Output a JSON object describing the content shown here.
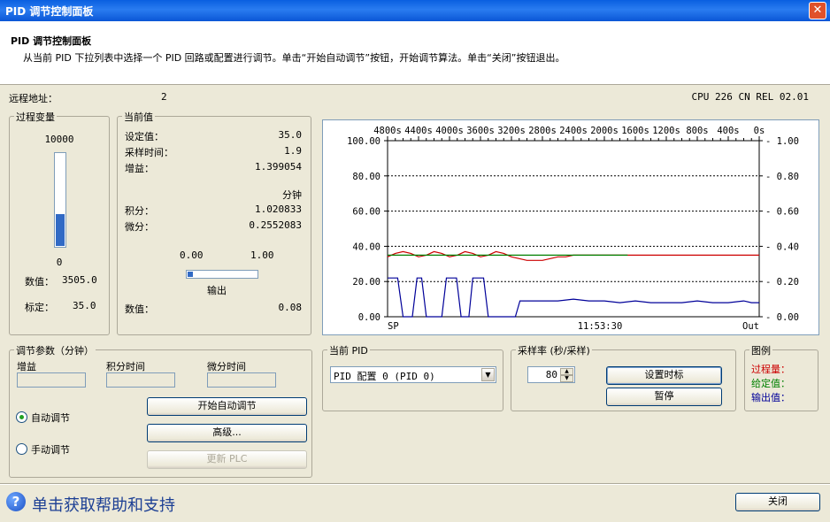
{
  "window": {
    "title": "PID 调节控制面板",
    "close_glyph": "✕"
  },
  "header": {
    "title": "PID 调节控制面板",
    "description": "从当前 PID 下拉列表中选择一个 PID 回路或配置进行调节。单击“开始自动调节”按钮，开始调节算法。单击“关闭”按钮退出。"
  },
  "remote": {
    "label": "远程地址：",
    "value": "2",
    "cpu": "CPU 226 CN REL 02.01"
  },
  "pv": {
    "legend": "过程变量",
    "max": "10000",
    "min": "0",
    "level": 0.3505,
    "value_label": "数值：",
    "value": "3505.0",
    "scale_label": "标定：",
    "scale": "35.0"
  },
  "current": {
    "legend": "当前值",
    "setpoint_label": "设定值：",
    "setpoint": "35.0",
    "sample_label": "采样时间：",
    "sample": "1.9",
    "gain_label": "增益：",
    "gain": "1.399054",
    "unit": "分钟",
    "integral_label": "积分：",
    "integral": "1.020833",
    "derivative_label": "微分：",
    "derivative": "0.2552083",
    "output_min": "0.00",
    "output_max": "1.00",
    "output_level": 0.08,
    "output_label": "输出",
    "value_label": "数值：",
    "value": "0.08"
  },
  "plot": {
    "top_ticks": [
      "4800s",
      "4400s",
      "4000s",
      "3600s",
      "3200s",
      "2800s",
      "2400s",
      "2000s",
      "1600s",
      "1200s",
      "800s",
      "400s",
      "0s"
    ],
    "left_ticks": [
      "100.00",
      "80.00",
      "60.00",
      "40.00",
      "20.00",
      "0.00"
    ],
    "right_ticks": [
      "1.00",
      "0.80",
      "0.60",
      "0.40",
      "0.20",
      "0.00"
    ],
    "bottom_left": "SP",
    "bottom_center": "11:53:30",
    "bottom_right": "Out"
  },
  "chart_data": {
    "type": "line",
    "x_axis": "seconds ago",
    "xlim": [
      4800,
      0
    ],
    "ylim_left": [
      0,
      100
    ],
    "ylim_right": [
      0,
      1
    ],
    "grid": true,
    "series": [
      {
        "name": "过程量",
        "axis": "left",
        "color": "#cc0000",
        "x": [
          4800,
          4700,
          4600,
          4500,
          4400,
          4300,
          4200,
          4100,
          4000,
          3900,
          3800,
          3700,
          3600,
          3500,
          3400,
          3300,
          3200,
          3100,
          3000,
          2900,
          2800,
          2700,
          2600,
          2500,
          2400,
          2300,
          2200,
          2100,
          2000,
          1900,
          1800,
          1700,
          1600,
          0
        ],
        "y": [
          34,
          36,
          37,
          36,
          34,
          35,
          37,
          36,
          34,
          35,
          37,
          36,
          34,
          35,
          37,
          36,
          34,
          33,
          32,
          32,
          32,
          33,
          34,
          34,
          35,
          35,
          35,
          35,
          35,
          35,
          35,
          35,
          35,
          35
        ]
      },
      {
        "name": "给定值",
        "axis": "left",
        "color": "#008000",
        "x": [
          4800,
          1700
        ],
        "y": [
          35,
          35
        ]
      },
      {
        "name": "输出值",
        "axis": "right",
        "color": "#000099",
        "x": [
          4800,
          4670,
          4600,
          4480,
          4420,
          4360,
          4300,
          4100,
          4040,
          3910,
          3850,
          3750,
          3700,
          3560,
          3500,
          3440,
          3380,
          3150,
          3090,
          2900,
          2600,
          2400,
          2200,
          2000,
          1800,
          1600,
          1400,
          1200,
          1000,
          800,
          600,
          400,
          200,
          100,
          0
        ],
        "y": [
          0.22,
          0.22,
          0,
          0,
          0.22,
          0.22,
          0,
          0,
          0.22,
          0.22,
          0,
          0,
          0.22,
          0.22,
          0,
          0,
          0,
          0,
          0.09,
          0.09,
          0.09,
          0.1,
          0.09,
          0.09,
          0.08,
          0.09,
          0.08,
          0.08,
          0.08,
          0.09,
          0.08,
          0.08,
          0.09,
          0.08,
          0.08
        ]
      }
    ]
  },
  "tuning": {
    "legend": "调节参数（分钟）",
    "gain_label": "增益",
    "integral_label": "积分时间",
    "derivative_label": "微分时间",
    "auto_label": "自动调节",
    "manual_label": "手动调节",
    "start_button": "开始自动调节",
    "advanced_button": "高级...",
    "update_button": "更新 PLC"
  },
  "current_pid": {
    "legend": "当前 PID",
    "selected": "PID 配置 0 (PID 0)"
  },
  "sampling": {
    "legend": "采样率 (秒/采样)",
    "value": "80",
    "set_button": "设置时标",
    "pause_button": "暂停"
  },
  "legend_box": {
    "legend": "图例",
    "pv_label": "过程量：",
    "pv_color": "#cc0000",
    "sp_label": "给定值：",
    "sp_color": "#008000",
    "out_label": "输出值：",
    "out_color": "#000099"
  },
  "footer": {
    "help_text": "单击获取帮助和支持",
    "close_button": "关闭"
  }
}
